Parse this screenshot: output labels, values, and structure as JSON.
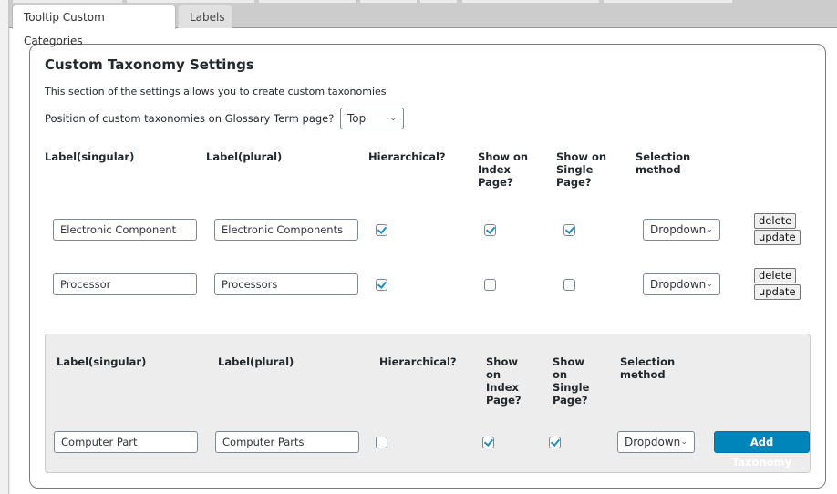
{
  "tabs": [
    {
      "label": "Tooltip Custom Categories",
      "active": true
    },
    {
      "label": "Labels",
      "active": false
    }
  ],
  "section": {
    "title": "Custom Taxonomy Settings",
    "description": "This section of the settings allows you to create custom taxonomies",
    "position_label": "Position of custom taxonomies on Glossary Term page?",
    "position_value": "Top"
  },
  "headers": {
    "singular": "Label(singular)",
    "plural": "Label(plural)",
    "hierarchical": "Hierarchical?",
    "show_index_l1": "Show on",
    "show_index_l2": "Index",
    "show_index_l3": "Page?",
    "show_single_l1": "Show on",
    "show_single_l2": "Single",
    "show_single_l3": "Page?",
    "selection_l1": "Selection",
    "selection_l2": "method"
  },
  "taxonomies": [
    {
      "singular": "Electronic Component",
      "plural": "Electronic Components",
      "hierarchical": true,
      "show_index": true,
      "show_single": true,
      "selection": "Dropdown",
      "delete_label": "delete",
      "update_label": "update"
    },
    {
      "singular": "Processor",
      "plural": "Processors",
      "hierarchical": true,
      "show_index": false,
      "show_single": false,
      "selection": "Dropdown",
      "delete_label": "delete",
      "update_label": "update"
    }
  ],
  "new_taxonomy": {
    "headers": {
      "singular": "Label(singular)",
      "plural": "Label(plural)",
      "hierarchical": "Hierarchical?",
      "show_index": [
        "Show",
        "on",
        "Index",
        "Page?"
      ],
      "show_single": [
        "Show",
        "on",
        "Single",
        "Page?"
      ],
      "selection": [
        "Selection",
        "method"
      ]
    },
    "singular": "Computer Part",
    "plural": "Computer Parts",
    "hierarchical": false,
    "show_index": true,
    "show_single": true,
    "selection": "Dropdown",
    "add_label": "Add Taxonomy"
  },
  "icons": {
    "chevron": "⌄"
  },
  "colors": {
    "primary_button": "#0085ba",
    "checkmark": "#1e8cbe",
    "add_box_bg": "#ededed"
  }
}
